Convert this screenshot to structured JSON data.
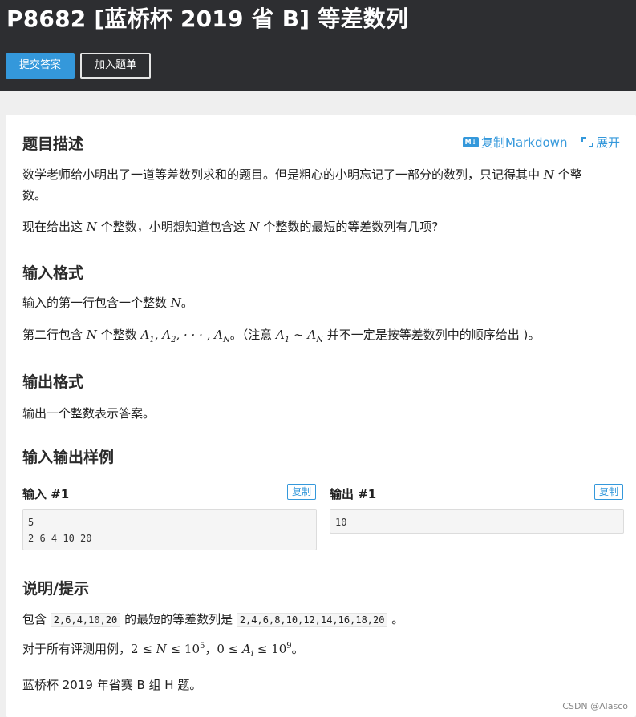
{
  "header": {
    "title": "P8682 [蓝桥杯 2019 省 B] 等差数列",
    "submit_label": "提交答案",
    "add_list_label": "加入题单"
  },
  "description": {
    "heading": "题目描述",
    "copy_markdown_label": "复制Markdown",
    "expand_label": "展开",
    "md_badge": "M↓",
    "para1_a": "数学老师给小明出了一道等差数列求和的题目。但是粗心的小明忘记了一部分的数列，只记得其中",
    "para1_var": "N",
    "para1_b": "个整",
    "para1_c": "数。",
    "para2_a": "现在给出这",
    "para2_var1": "N",
    "para2_b": "个整数，小明想知道包含这",
    "para2_var2": "N",
    "para2_c": "个整数的最短的等差数列有几项?"
  },
  "input_format": {
    "heading": "输入格式",
    "line1_a": "输入的第一行包含一个整数",
    "line1_var": "N",
    "line1_b": "。",
    "line2_a": "第二行包含",
    "line2_var": "N",
    "line2_b": "个整数",
    "line2_seq_a": "A",
    "line2_sub1": "1",
    "line2_seq_sep1": ", A",
    "line2_sub2": "2",
    "line2_seq_mid": ", · · · , A",
    "line2_subN": "N",
    "line2_c": "。（注意",
    "line2_range_a": "A",
    "line2_range_sub1": "1",
    "line2_tilde": " ∼ A",
    "line2_range_subN": "N",
    "line2_d": "并不一定是按等差数列中的顺序给出 )。"
  },
  "output_format": {
    "heading": "输出格式",
    "text": "输出一个整数表示答案。"
  },
  "samples": {
    "heading": "输入输出样例",
    "input_label": "输入 #1",
    "output_label": "输出 #1",
    "copy_label": "复制",
    "input_line1": "5",
    "input_line2": "2 6 4 10 20",
    "output_line1": "10"
  },
  "hint": {
    "heading": "说明/提示",
    "line1_a": "包含",
    "line1_code1": "2,6,4,10,20",
    "line1_b": "的最短的等差数列是",
    "line1_code2": "2,4,6,8,10,12,14,16,18,20",
    "line1_c": "。",
    "line2_a": "对于所有评测用例，",
    "line2_expr1_a": "2 ≤ ",
    "line2_expr1_var": "N",
    "line2_expr1_b": " ≤ 10",
    "line2_exp1": "5",
    "line2_comma": "，",
    "line2_expr2_a": "0 ≤ ",
    "line2_expr2_var": "A",
    "line2_expr2_sub": "i",
    "line2_expr2_b": " ≤ 10",
    "line2_exp2": "9",
    "line2_end": "。",
    "line3": "蓝桥杯 2019 年省赛 B 组 H 题。"
  },
  "watermark": "CSDN @Alasco",
  "colors": {
    "header_bg": "#2d2e31",
    "accent": "#3498db",
    "page_bg": "#efefef"
  }
}
